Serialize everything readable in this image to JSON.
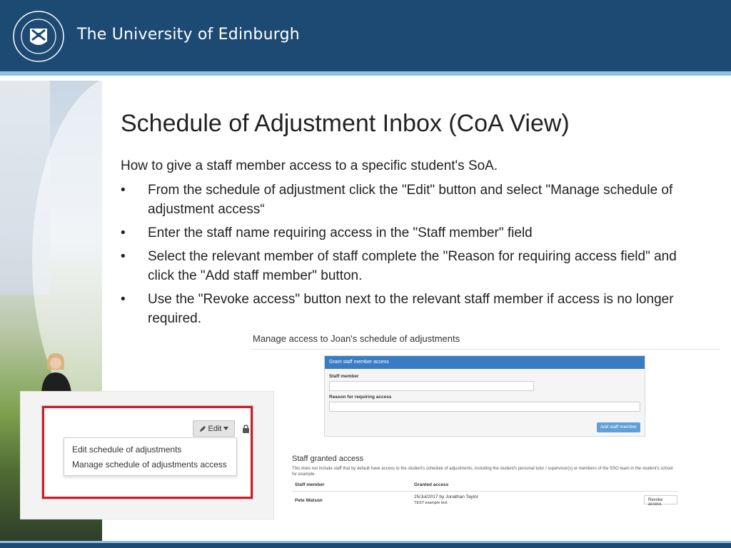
{
  "header": {
    "brand": "The University of Edinburgh",
    "crest_icon": "university-crest-icon",
    "colors": {
      "band": "#1d4a73",
      "rule": "#8fc0e4"
    }
  },
  "slide": {
    "title": "Schedule of Adjustment Inbox (CoA View)",
    "intro": "How to give a staff member access to a specific student's SoA.",
    "bullets": [
      "From the schedule of adjustment click the \"Edit\" button and select \"Manage schedule of adjustment access“",
      "Enter the staff name requiring access in the \"Staff member\" field",
      "Select the relevant member of staff complete the \"Reason for requiring access field\" and click the \"Add staff member\" button.",
      "Use the \"Revoke access\" button next to the relevant staff member if access is no longer required."
    ]
  },
  "manage_screenshot": {
    "heading": "Manage access to Joan's schedule of adjustments",
    "grant_panel": {
      "header": "Grant staff member access",
      "staff_member_label": "Staff member",
      "reason_label": "Reason for requiring access",
      "add_button": "Add staff member"
    },
    "granted": {
      "title": "Staff granted access",
      "note": "This does not include staff that by default have access to the student's schedule of adjustments, including the student's personal tutor / supervisor(s) or members of the SSO team in the student's school for example.",
      "columns": [
        "Staff member",
        "Granted access"
      ],
      "rows": [
        {
          "staff": "Pete Watson",
          "granted": "25/Jul/2017 by Jonathan Taylor",
          "reason": "TEST example text",
          "action": "Revoke access"
        }
      ]
    }
  },
  "edit_screenshot": {
    "edit_button": "Edit",
    "menu": [
      "Edit schedule of adjustments",
      "Manage schedule of adjustments access"
    ],
    "highlight_color": "#c8202b"
  }
}
